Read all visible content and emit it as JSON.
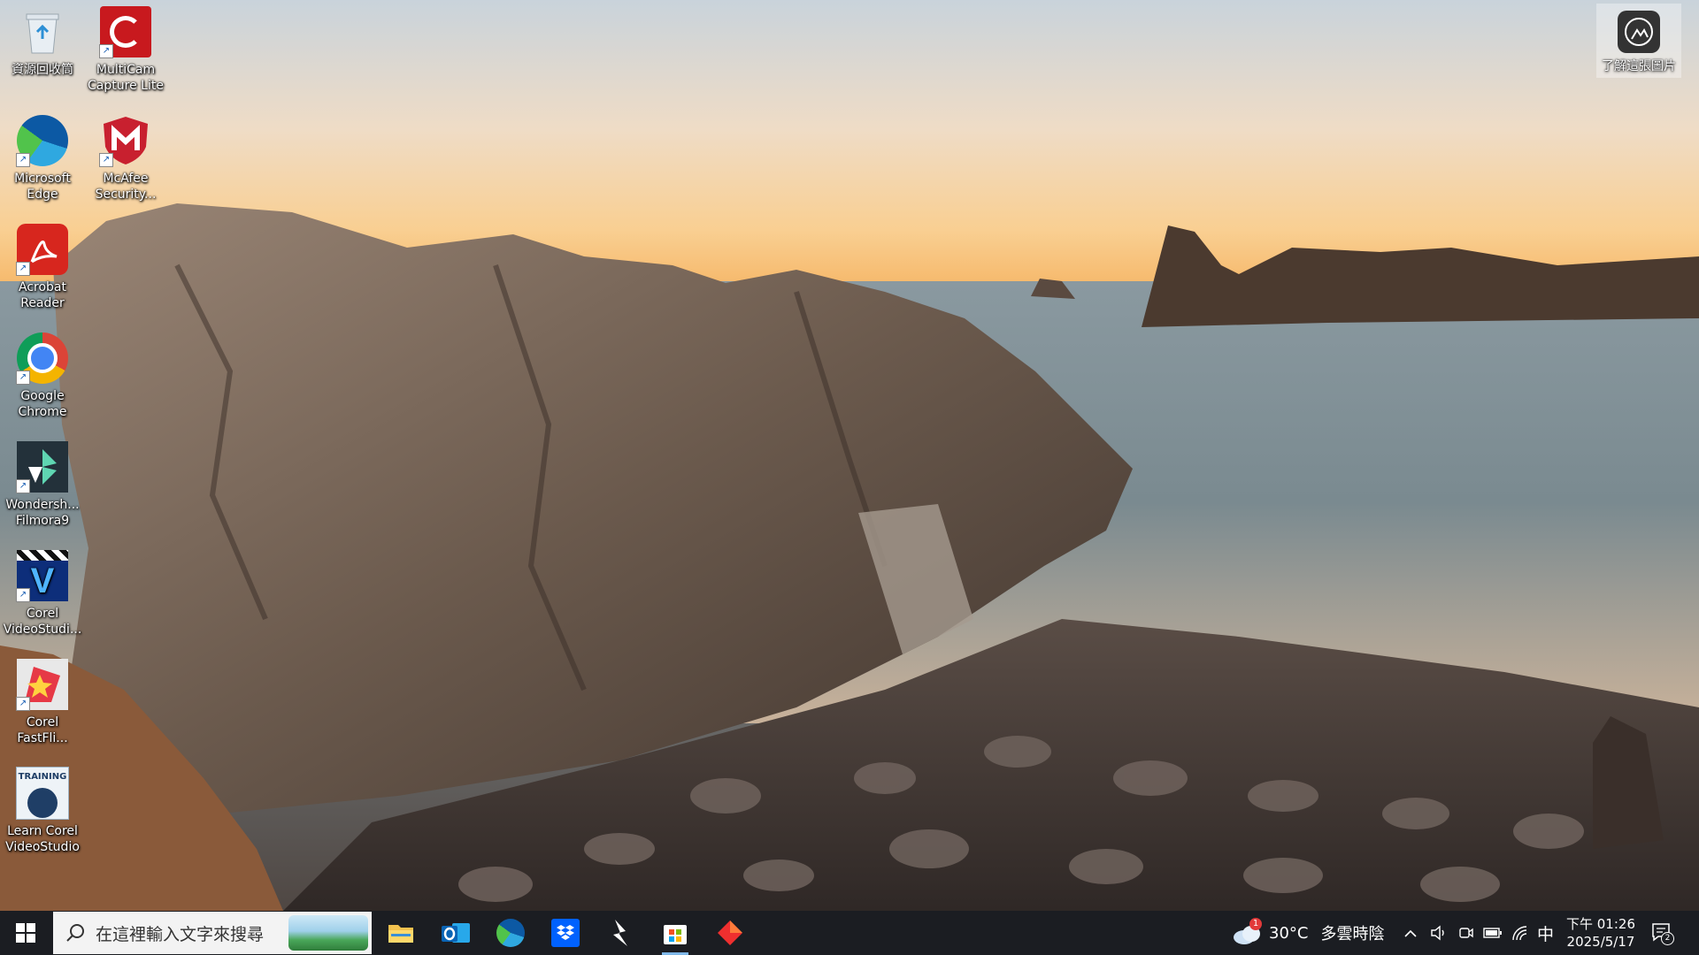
{
  "desktop": {
    "icons": [
      {
        "label": "資源回收筒"
      },
      {
        "label": "MultiCam Capture Lite"
      },
      {
        "label": "Microsoft Edge"
      },
      {
        "label": "McAfee Security..."
      },
      {
        "label": "Acrobat Reader"
      },
      {
        "label": "Google Chrome"
      },
      {
        "label": "Wondersh... Filmora9"
      },
      {
        "label": "Corel VideoStudi..."
      },
      {
        "label": "Corel FastFli..."
      },
      {
        "label": "Learn Corel VideoStudio"
      }
    ],
    "learn_picture": {
      "label": "了解這張圖片"
    }
  },
  "taskbar": {
    "search": {
      "placeholder": "在這裡輸入文字來搜尋"
    },
    "pinned": [
      {
        "icon": "file-explorer-icon"
      },
      {
        "icon": "outlook-icon"
      },
      {
        "icon": "edge-icon"
      },
      {
        "icon": "dropbox-icon"
      },
      {
        "icon": "app-lightning-icon"
      },
      {
        "icon": "microsoft-store-icon"
      },
      {
        "icon": "app-red-diamond-icon"
      }
    ],
    "weather": {
      "temp": "30°C",
      "condition": "多雲時陰",
      "badge": "1"
    },
    "ime": "中",
    "clock": {
      "time": "下午 01:26",
      "date": "2025/5/17"
    },
    "notifications": {
      "count": "2"
    }
  },
  "colors": {
    "taskbar": "#1b1d22",
    "accent": "#7fb7e8"
  }
}
